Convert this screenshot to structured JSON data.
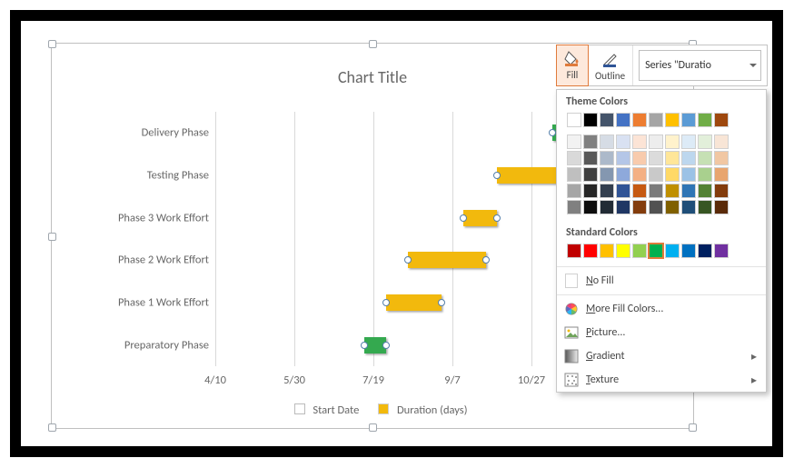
{
  "chart_data": {
    "type": "bar",
    "orientation": "horizontal-stacked-gantt",
    "title": "Chart Title",
    "xlabel": "",
    "ylabel": "",
    "x_axis": {
      "type": "date",
      "ticks": [
        "4/10",
        "5/30",
        "7/19",
        "9/7",
        "10/27"
      ],
      "tick_serials": [
        42104,
        42154,
        42204,
        42254,
        42304
      ],
      "range": [
        42104,
        42354
      ]
    },
    "categories": [
      "Preparatory Phase",
      "Phase 1 Work Effort",
      "Phase 2 Work Effort",
      "Phase 3 Work Effort",
      "Testing Phase",
      "Delivery Phase"
    ],
    "series": [
      {
        "name": "Start Date",
        "fill": "transparent",
        "values": [
          42198,
          42212,
          42226,
          42261,
          42282,
          42317
        ]
      },
      {
        "name": "Duration (days)",
        "fill": "#f2b90d",
        "values": [
          14,
          35,
          49,
          21,
          42,
          14
        ],
        "point_fill_overrides": {
          "0": "#34a94f",
          "5": "#34a94f"
        }
      }
    ],
    "selected_series": "Duration (days)",
    "legend_position": "bottom"
  },
  "chart": {
    "title": "Chart Title",
    "xticks": [
      "4/10",
      "5/30",
      "7/19",
      "9/7",
      "10/27"
    ],
    "yticks": [
      "Delivery Phase",
      "Testing Phase",
      "Phase 3 Work Effort",
      "Phase 2 Work Effort",
      "Phase 1 Work Effort",
      "Preparatory Phase"
    ],
    "legend_start": "Start Date",
    "legend_duration": "Duration (days)"
  },
  "toolbar": {
    "fill": "Fill",
    "outline": "Outline",
    "selector_value": "Series \"Duratio"
  },
  "flyout": {
    "theme_heading": "Theme Colors",
    "standard_heading": "Standard Colors",
    "no_fill": "o Fill",
    "no_fill_u": "N",
    "more_colors": "ore Fill Colors...",
    "more_colors_u": "M",
    "picture": "icture...",
    "picture_u": "P",
    "gradient": "radient",
    "gradient_u": "G",
    "texture": "exture",
    "texture_u": "T"
  },
  "colors": {
    "theme_row0": [
      "#ffffff",
      "#000000",
      "#44546a",
      "#4472c4",
      "#ed7d31",
      "#a5a5a5",
      "#ffc000",
      "#5b9bd5",
      "#70ad47",
      "#9e480e"
    ],
    "theme_shades": [
      [
        "#f2f2f2",
        "#808080",
        "#d6dce5",
        "#d9e1f2",
        "#fce4d6",
        "#ededed",
        "#fff2cc",
        "#ddebf7",
        "#e2efda",
        "#f8e5d6"
      ],
      [
        "#d9d9d9",
        "#595959",
        "#acb9ca",
        "#b4c6e7",
        "#f8cbad",
        "#dbdbdb",
        "#ffe699",
        "#bdd7ee",
        "#c6e0b4",
        "#f1c7a3"
      ],
      [
        "#bfbfbf",
        "#404040",
        "#8497b0",
        "#8ea9db",
        "#f4b084",
        "#c9c9c9",
        "#ffd966",
        "#9bc2e6",
        "#a9d08e",
        "#e8a56f"
      ],
      [
        "#a6a6a6",
        "#262626",
        "#333f4f",
        "#305496",
        "#c65911",
        "#7b7b7b",
        "#bf8f00",
        "#2f75b5",
        "#548235",
        "#833c0c"
      ],
      [
        "#808080",
        "#0d0d0d",
        "#222b35",
        "#203764",
        "#833c0c",
        "#525252",
        "#806000",
        "#1f4e78",
        "#375623",
        "#5a2a09"
      ]
    ],
    "standard": [
      "#c00000",
      "#ff0000",
      "#ffc000",
      "#ffff00",
      "#92d050",
      "#00b050",
      "#00b0f0",
      "#0070c0",
      "#002060",
      "#7030a0"
    ],
    "selected_standard_index": 5
  }
}
